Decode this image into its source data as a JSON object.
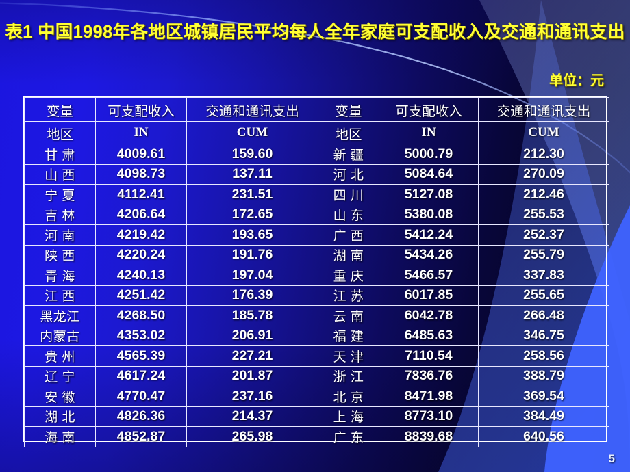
{
  "slide": {
    "title": "表1 中国1998年各地区城镇居民平均每人全年家庭可支配收入及交通和通讯支出",
    "unit_note": "单位：元",
    "page_number": "5",
    "accent_color": "#ffff33",
    "background_left_color": "#1b16e0",
    "background_right_color": "#030214",
    "table_border_color": "#ffffff",
    "text_color": "#ffffff"
  },
  "table": {
    "headers_top": [
      "变量",
      "可支配收入",
      "交通和通讯支出",
      "变量",
      "可支配收入",
      "交通和通讯支出"
    ],
    "headers_sub": [
      "地区",
      "IN",
      "CUM",
      "地区",
      "IN",
      "CUM"
    ],
    "rows": [
      {
        "region_left": "甘  肃",
        "in_left": "4009.61",
        "cum_left": "159.60",
        "region_right": "新  疆",
        "in_right": "5000.79",
        "cum_right": "212.30"
      },
      {
        "region_left": "山  西",
        "in_left": "4098.73",
        "cum_left": "137.11",
        "region_right": "河  北",
        "in_right": "5084.64",
        "cum_right": "270.09"
      },
      {
        "region_left": "宁  夏",
        "in_left": "4112.41",
        "cum_left": "231.51",
        "region_right": "四  川",
        "in_right": "5127.08",
        "cum_right": "212.46"
      },
      {
        "region_left": "吉  林",
        "in_left": "4206.64",
        "cum_left": "172.65",
        "region_right": "山  东",
        "in_right": "5380.08",
        "cum_right": "255.53"
      },
      {
        "region_left": "河  南",
        "in_left": "4219.42",
        "cum_left": "193.65",
        "region_right": "广  西",
        "in_right": "5412.24",
        "cum_right": "252.37"
      },
      {
        "region_left": "陕  西",
        "in_left": "4220.24",
        "cum_left": "191.76",
        "region_right": "湖  南",
        "in_right": "5434.26",
        "cum_right": "255.79"
      },
      {
        "region_left": "青  海",
        "in_left": "4240.13",
        "cum_left": "197.04",
        "region_right": "重  庆",
        "in_right": "5466.57",
        "cum_right": "337.83"
      },
      {
        "region_left": "江  西",
        "in_left": "4251.42",
        "cum_left": "176.39",
        "region_right": "江  苏",
        "in_right": "6017.85",
        "cum_right": "255.65"
      },
      {
        "region_left": "黑龙江",
        "in_left": "4268.50",
        "cum_left": "185.78",
        "region_right": "云  南",
        "in_right": "6042.78",
        "cum_right": "266.48"
      },
      {
        "region_left": "内蒙古",
        "in_left": "4353.02",
        "cum_left": "206.91",
        "region_right": "福  建",
        "in_right": "6485.63",
        "cum_right": "346.75"
      },
      {
        "region_left": "贵  州",
        "in_left": "4565.39",
        "cum_left": "227.21",
        "region_right": "天  津",
        "in_right": "7110.54",
        "cum_right": "258.56"
      },
      {
        "region_left": "辽  宁",
        "in_left": "4617.24",
        "cum_left": "201.87",
        "region_right": "浙  江",
        "in_right": "7836.76",
        "cum_right": "388.79"
      },
      {
        "region_left": "安  徽",
        "in_left": "4770.47",
        "cum_left": "237.16",
        "region_right": "北  京",
        "in_right": "8471.98",
        "cum_right": "369.54"
      },
      {
        "region_left": "湖  北",
        "in_left": "4826.36",
        "cum_left": "214.37",
        "region_right": "上  海",
        "in_right": "8773.10",
        "cum_right": "384.49"
      },
      {
        "region_left": "海  南",
        "in_left": "4852.87",
        "cum_left": "265.98",
        "region_right": "广  东",
        "in_right": "8839.68",
        "cum_right": "640.56"
      }
    ]
  }
}
